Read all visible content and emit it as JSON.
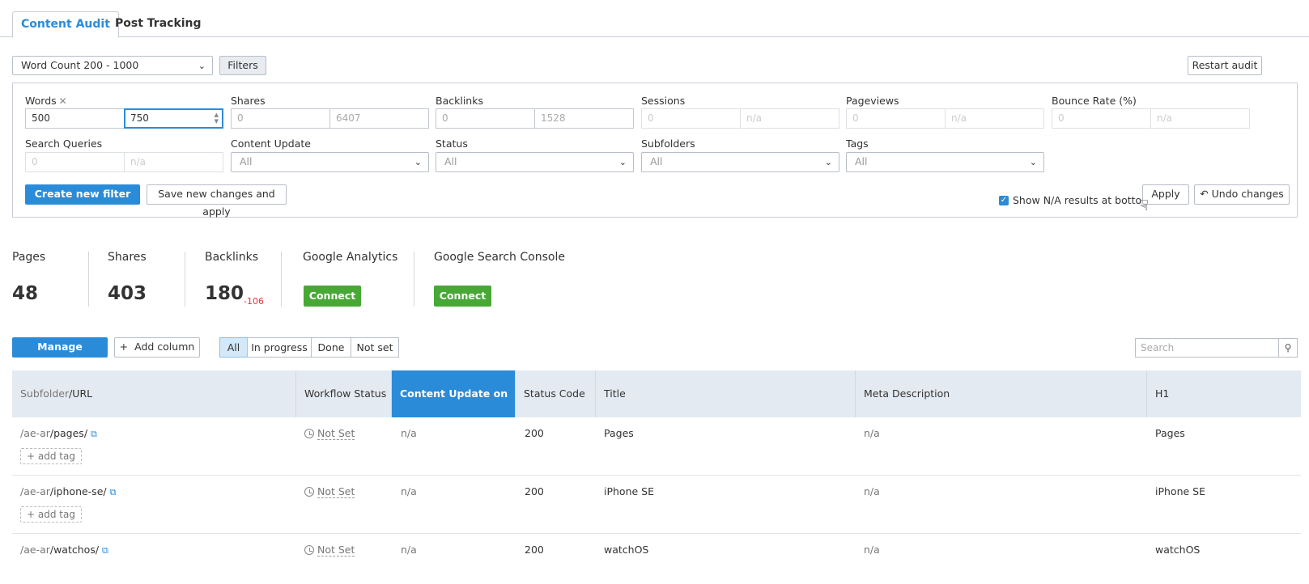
{
  "tabs": [
    {
      "label": "Content Audit"
    },
    {
      "label": "Post Tracking"
    }
  ],
  "toolbar": {
    "filter_view": "Word Count 200 - 1000",
    "filters_label": "Filters",
    "restart_label": "Restart audit"
  },
  "filters": {
    "words": {
      "label": "Words",
      "min": "500",
      "max": "750"
    },
    "shares": {
      "label": "Shares",
      "min": "0",
      "max": "6407"
    },
    "backlinks": {
      "label": "Backlinks",
      "min": "0",
      "max": "1528"
    },
    "sessions": {
      "label": "Sessions",
      "min": "0",
      "max": "n/a"
    },
    "pageviews": {
      "label": "Pageviews",
      "min": "0",
      "max": "n/a"
    },
    "bounce_rate": {
      "label": "Bounce Rate (%)",
      "min": "0",
      "max": "n/a"
    },
    "search_queries": {
      "label": "Search Queries",
      "min": "0",
      "max": "n/a"
    },
    "content_update": {
      "label": "Content Update",
      "value": "All"
    },
    "status": {
      "label": "Status",
      "value": "All"
    },
    "subfolders": {
      "label": "Subfolders",
      "value": "All"
    },
    "tags": {
      "label": "Tags",
      "value": "All"
    },
    "create_view_label": "Create new filter view",
    "save_apply_label": "Save new changes and apply",
    "show_na_label": "Show N/A results at bottom",
    "apply_label": "Apply",
    "undo_label": "Undo changes"
  },
  "summary": {
    "pages": {
      "label": "Pages",
      "value": "48"
    },
    "shares": {
      "label": "Shares",
      "value": "403"
    },
    "backlinks": {
      "label": "Backlinks",
      "value": "180",
      "delta": "-106"
    },
    "ga": {
      "label": "Google Analytics",
      "button": "Connect"
    },
    "gsc": {
      "label": "Google Search Console",
      "button": "Connect"
    }
  },
  "controls": {
    "manage_columns": "Manage columns",
    "add_column": "Add column",
    "segments": [
      "All",
      "In progress",
      "Done",
      "Not set"
    ],
    "search_placeholder": "Search"
  },
  "table": {
    "headers": {
      "subfolder": "Subfolder",
      "url": "/URL",
      "workflow": "Workflow Status",
      "content_update": "Content Update on",
      "status_code": "Status Code",
      "title": "Title",
      "meta": "Meta Description",
      "h1": "H1"
    },
    "add_tag_label": "add tag",
    "rows": [
      {
        "prefix": "/ae-ar",
        "path": "/pages/",
        "workflow": "Not Set",
        "update": "n/a",
        "code": "200",
        "title": "Pages",
        "meta": "n/a",
        "h1": "Pages"
      },
      {
        "prefix": "/ae-ar",
        "path": "/iphone-se/",
        "workflow": "Not Set",
        "update": "n/a",
        "code": "200",
        "title": "iPhone SE",
        "meta": "n/a",
        "h1": "iPhone SE"
      },
      {
        "prefix": "/ae-ar",
        "path": "/watchos/",
        "workflow": "Not Set",
        "update": "n/a",
        "code": "200",
        "title": "watchOS",
        "meta": "n/a",
        "h1": "watchOS"
      }
    ]
  }
}
